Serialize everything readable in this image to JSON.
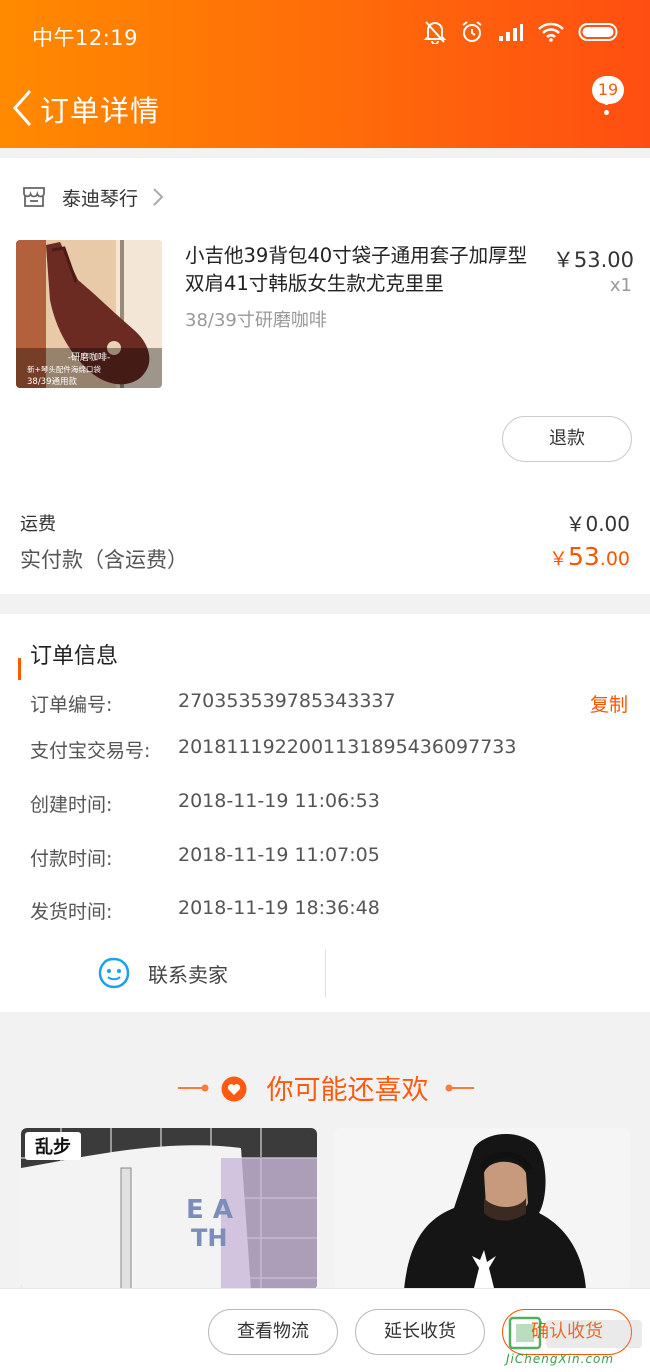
{
  "status_bar": {
    "time": "中午12:19"
  },
  "nav": {
    "title": "订单详情",
    "badge_count": "19"
  },
  "order": {
    "shop_name": "泰迪琴行",
    "product": {
      "title": "小吉他39背包40寸袋子通用套子加厚型双肩41寸韩版女生款尤克里里",
      "sku": "38/39寸研磨咖啡",
      "price": "￥53.00",
      "qty": "x1",
      "img_overlay_1": "-研磨咖啡-",
      "img_overlay_2": "新+琴头配件海绵口袋",
      "img_overlay_3": "38/39通用款"
    },
    "refund_label": "退款",
    "shipping_label": "运费",
    "shipping_value": "￥0.00",
    "paid_label": "实付款（含运费）",
    "paid_currency": "￥",
    "paid_int": "53",
    "paid_dec": ".00"
  },
  "order_info": {
    "title": "订单信息",
    "copy_label": "复制",
    "rows": [
      {
        "label": "订单编号:",
        "value": "270353539785343337"
      },
      {
        "label": "支付宝交易号:",
        "value": "2018111922001131895436097733"
      },
      {
        "label": "创建时间:",
        "value": "2018-11-19 11:06:53"
      },
      {
        "label": "付款时间:",
        "value": "2018-11-19 11:07:05"
      },
      {
        "label": "发货时间:",
        "value": "2018-11-19 18:36:48"
      }
    ],
    "contact_label": "联系卖家"
  },
  "recommend": {
    "title": "你可能还喜欢",
    "card1_tag": "乱步"
  },
  "bottom_bar": {
    "logistics": "查看物流",
    "extend": "延长收货",
    "confirm": "确认收货"
  },
  "watermark": {
    "text": "JiChengXin.com"
  },
  "colors": {
    "accent": "#ff5500",
    "header_start": "#ff8a00",
    "header_end": "#ff4e12"
  }
}
